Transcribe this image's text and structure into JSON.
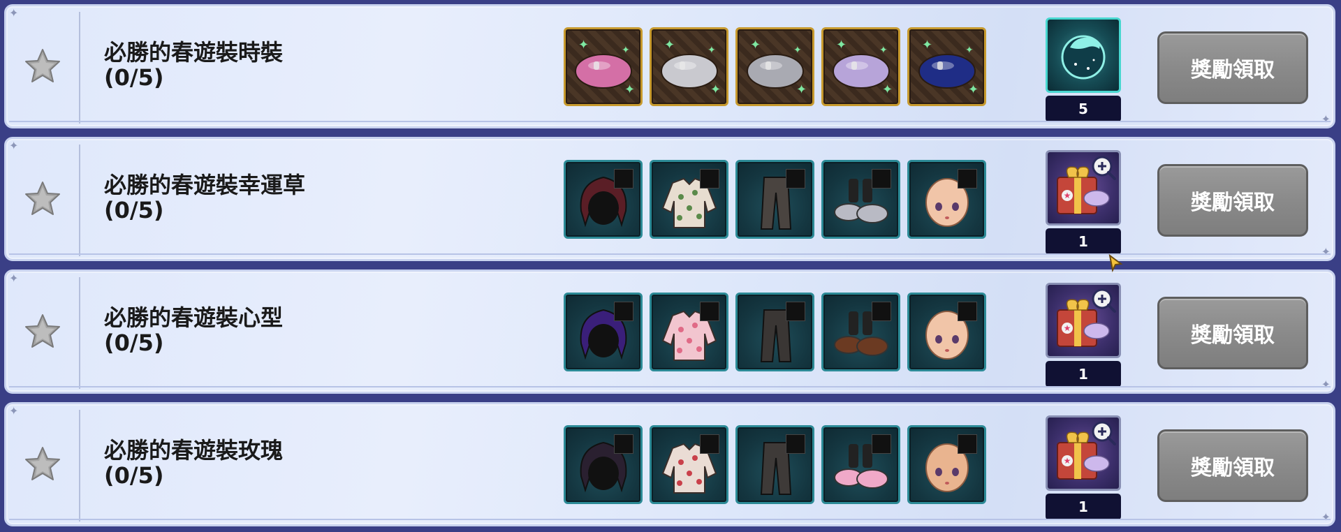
{
  "rows": [
    {
      "title": "必勝的春遊裝時裝",
      "progress": "(0/5)",
      "item_frame": "gold",
      "items": [
        {
          "icon": "pink-beret-icon",
          "color": "#d46fa6"
        },
        {
          "icon": "light-gray-beret-icon",
          "color": "#c9c9cf"
        },
        {
          "icon": "gray-beret-icon",
          "color": "#a9aab2"
        },
        {
          "icon": "lavender-beret-icon",
          "color": "#b7a4d9"
        },
        {
          "icon": "navy-beret-icon",
          "color": "#1f2d86"
        }
      ],
      "reward": {
        "icon": "moon-dragon-icon",
        "style": "cyan",
        "qty": "5"
      },
      "claim_label": "獎勵領取"
    },
    {
      "title": "必勝的春遊裝幸運草",
      "progress": "(0/5)",
      "item_frame": "teal",
      "items": [
        {
          "icon": "hair-icon",
          "color": "#5a1e26"
        },
        {
          "icon": "clover-shirt-icon",
          "color": "#e7ddd0"
        },
        {
          "icon": "pants-icon",
          "color": "#4a4440"
        },
        {
          "icon": "shoes-icon",
          "color": "#b9bac4"
        },
        {
          "icon": "face-icon",
          "color": "#f1c5a8"
        }
      ],
      "reward": {
        "icon": "gift-box-icon",
        "style": "purple",
        "qty": "1"
      },
      "claim_label": "獎勵領取"
    },
    {
      "title": "必勝的春遊裝心型",
      "progress": "(0/5)",
      "item_frame": "teal",
      "items": [
        {
          "icon": "hair-icon",
          "color": "#3a1f7a"
        },
        {
          "icon": "heart-shirt-icon",
          "color": "#f2c5cf"
        },
        {
          "icon": "pants-icon",
          "color": "#3a3634"
        },
        {
          "icon": "shoes-icon",
          "color": "#6b3a22"
        },
        {
          "icon": "face-icon",
          "color": "#f1c5a8"
        }
      ],
      "reward": {
        "icon": "gift-box-icon",
        "style": "purple",
        "qty": "1"
      },
      "claim_label": "獎勵領取"
    },
    {
      "title": "必勝的春遊裝玫瑰",
      "progress": "(0/5)",
      "item_frame": "teal",
      "items": [
        {
          "icon": "hair-icon",
          "color": "#2a2030"
        },
        {
          "icon": "rose-shirt-icon",
          "color": "#eadcd4"
        },
        {
          "icon": "pants-icon",
          "color": "#3e3a38"
        },
        {
          "icon": "shoes-icon",
          "color": "#f0a9c8"
        },
        {
          "icon": "face-icon",
          "color": "#e9b48f"
        }
      ],
      "reward": {
        "icon": "gift-box-icon",
        "style": "purple",
        "qty": "1"
      },
      "claim_label": "獎勵領取"
    }
  ]
}
